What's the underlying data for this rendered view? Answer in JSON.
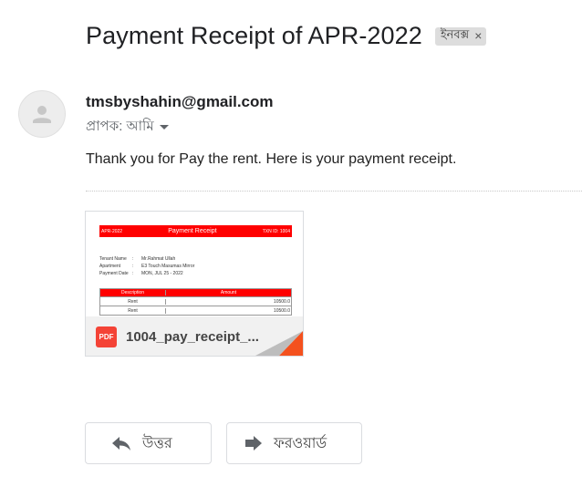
{
  "email": {
    "subject": "Payment Receipt of APR-2022",
    "label": "ইনবক্স",
    "label_close": "×",
    "sender": "tmsbyshahin@gmail.com",
    "to_text": "প্রাপক: আমি",
    "body": "Thank you for Pay the rent. Here is your payment receipt."
  },
  "attachment": {
    "file_name": "1004_pay_receipt_...",
    "type_badge": "PDF",
    "preview": {
      "header_left": "APR-2022",
      "header_title": "Payment Receipt",
      "header_right": "TXN ID: 1004",
      "fields": [
        {
          "key": "Tenant Name",
          "sep": ":",
          "value": "Mr.Rahmat Ullah"
        },
        {
          "key": "Apartment",
          "sep": ":",
          "value": "E3 Touch Masumas Mirror"
        },
        {
          "key": "Payment Date",
          "sep": ":",
          "value": "MON, JUL 25 - 2022"
        }
      ],
      "table_headers": [
        "Description",
        "Amount"
      ],
      "rows": [
        {
          "desc": "Rent",
          "amount": "10500.0"
        },
        {
          "desc": "Rent",
          "amount": "10500.0"
        }
      ]
    }
  },
  "actions": {
    "reply_label": "উত্তর",
    "forward_label": "ফরওয়ার্ড"
  },
  "icons": {
    "avatar": "person-icon",
    "reply": "reply-arrow-icon",
    "forward": "forward-arrow-icon",
    "pdf": "pdf-icon",
    "caret": "chevron-down-icon"
  },
  "colors": {
    "pdf_red": "#f44336",
    "receipt_red": "#ff0000",
    "chip_bg": "#dddddd"
  }
}
